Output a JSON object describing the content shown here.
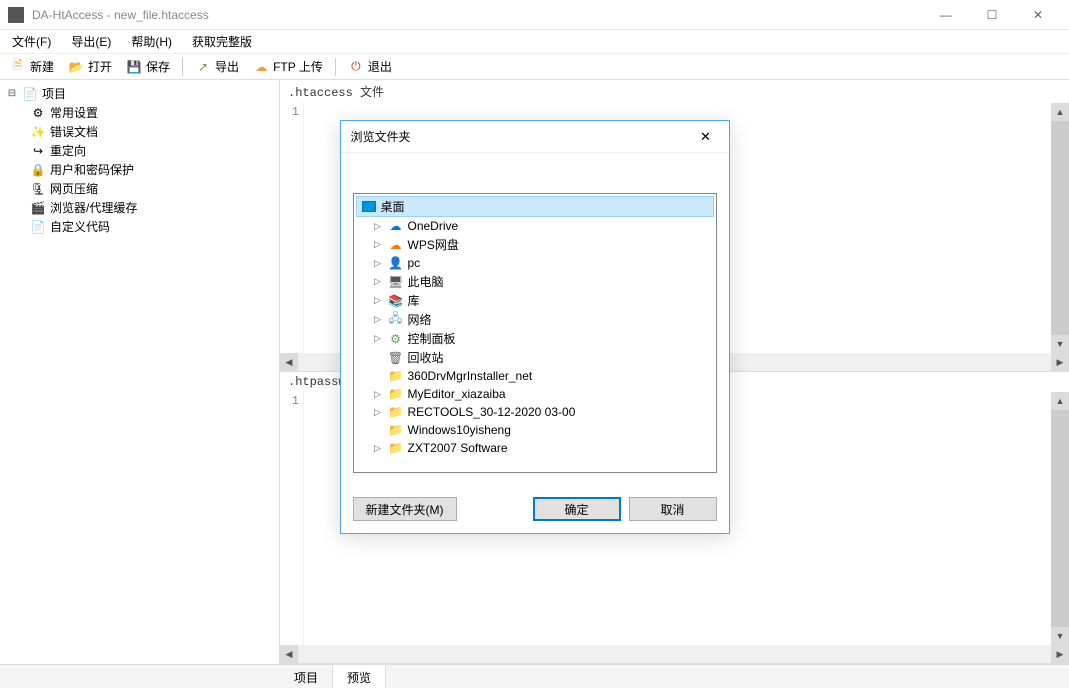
{
  "window": {
    "title": "DA-HtAccess - new_file.htaccess"
  },
  "winControls": {
    "minimize": "—",
    "maximize": "☐",
    "close": "✕"
  },
  "menubar": {
    "items": [
      {
        "label": "文件(F)"
      },
      {
        "label": "导出(E)"
      },
      {
        "label": "帮助(H)"
      },
      {
        "label": "获取完整版"
      }
    ]
  },
  "toolbar": {
    "items": [
      {
        "label": "新建",
        "icon": "new"
      },
      {
        "label": "打开",
        "icon": "open"
      },
      {
        "label": "保存",
        "icon": "save"
      },
      {
        "sep": true
      },
      {
        "label": "导出",
        "icon": "export"
      },
      {
        "label": "FTP 上传",
        "icon": "ftp"
      },
      {
        "sep": true
      },
      {
        "label": "退出",
        "icon": "exit"
      }
    ]
  },
  "sidebar": {
    "root": "项目",
    "children": [
      {
        "label": "常用设置",
        "icon": "settings"
      },
      {
        "label": "错误文档",
        "icon": "errdoc"
      },
      {
        "label": "重定向",
        "icon": "redirect"
      },
      {
        "label": "用户和密码保护",
        "icon": "lock"
      },
      {
        "label": "网页压缩",
        "icon": "compress"
      },
      {
        "label": "浏览器/代理缓存",
        "icon": "cache"
      },
      {
        "label": "自定义代码",
        "icon": "code"
      }
    ]
  },
  "editor": {
    "section1_label": ".htaccess 文件",
    "section1_line": "1",
    "section2_label": ".htpasswd",
    "section2_line": "1"
  },
  "bottomTabs": {
    "tab1": "项目",
    "tab2": "预览"
  },
  "dialog": {
    "title": "浏览文件夹",
    "close": "✕",
    "root": "桌面",
    "items": [
      {
        "label": "OneDrive",
        "iconClass": "ic-cloud-blue",
        "glyph": "☁",
        "expandable": true
      },
      {
        "label": "WPS网盘",
        "iconClass": "ic-cloud-or",
        "glyph": "☁",
        "expandable": true
      },
      {
        "label": "pc",
        "iconClass": "ic-user",
        "glyph": "👤",
        "expandable": true
      },
      {
        "label": "此电脑",
        "iconClass": "ic-pc",
        "glyph": "🖥",
        "expandable": true
      },
      {
        "label": "库",
        "iconClass": "ic-lib",
        "glyph": "📚",
        "expandable": true
      },
      {
        "label": "网络",
        "iconClass": "ic-net",
        "glyph": "🖧",
        "expandable": true
      },
      {
        "label": "控制面板",
        "iconClass": "ic-cpl",
        "glyph": "⚙",
        "expandable": true
      },
      {
        "label": "回收站",
        "iconClass": "ic-recycle",
        "glyph": "🗑",
        "expandable": false
      },
      {
        "label": "360DrvMgrInstaller_net",
        "iconClass": "ic-folder",
        "glyph": "📁",
        "expandable": false
      },
      {
        "label": "MyEditor_xiazaiba",
        "iconClass": "ic-folder",
        "glyph": "📁",
        "expandable": true
      },
      {
        "label": "RECTOOLS_30-12-2020 03-00",
        "iconClass": "ic-folder",
        "glyph": "📁",
        "expandable": true
      },
      {
        "label": "Windows10yisheng",
        "iconClass": "ic-folder",
        "glyph": "📁",
        "expandable": false
      },
      {
        "label": "ZXT2007 Software",
        "iconClass": "ic-folder",
        "glyph": "📁",
        "expandable": true
      }
    ],
    "buttons": {
      "newFolder": "新建文件夹(M)",
      "ok": "确定",
      "cancel": "取消"
    }
  },
  "iconGlyphs": {
    "new": "🗎",
    "open": "📂",
    "save": "💾",
    "export": "↗",
    "ftp": "☁",
    "exit": "⏻",
    "settings": "⚙",
    "errdoc": "✨",
    "redirect": "↪",
    "lock": "🔒",
    "compress": "🗜",
    "cache": "🎬",
    "code": "📄",
    "project": "📄",
    "desktop": "🖥"
  }
}
